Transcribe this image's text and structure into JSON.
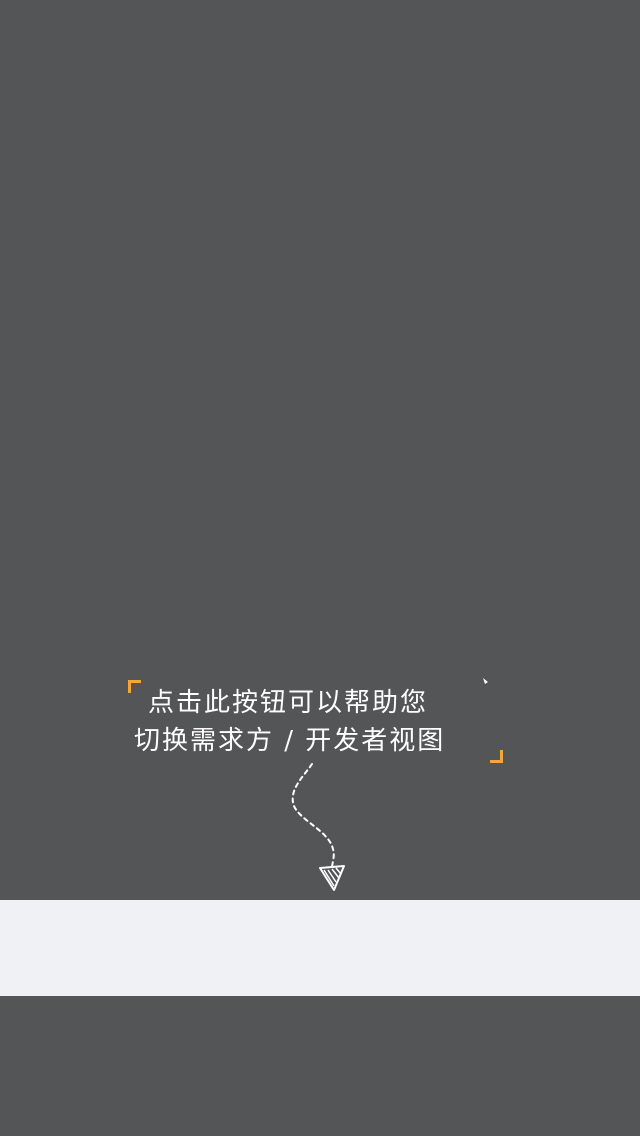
{
  "tip": {
    "line1": "点击此按钮可以帮助您",
    "line2": "切换需求方 / 开发者视图"
  },
  "colors": {
    "overlay": "#545557",
    "accent": "#f3a73a",
    "text": "#ffffff",
    "bar": "#f0f1f5"
  },
  "icons": {
    "arrow": "dashed-curved-arrow-icon",
    "spark": "spark-icon"
  }
}
